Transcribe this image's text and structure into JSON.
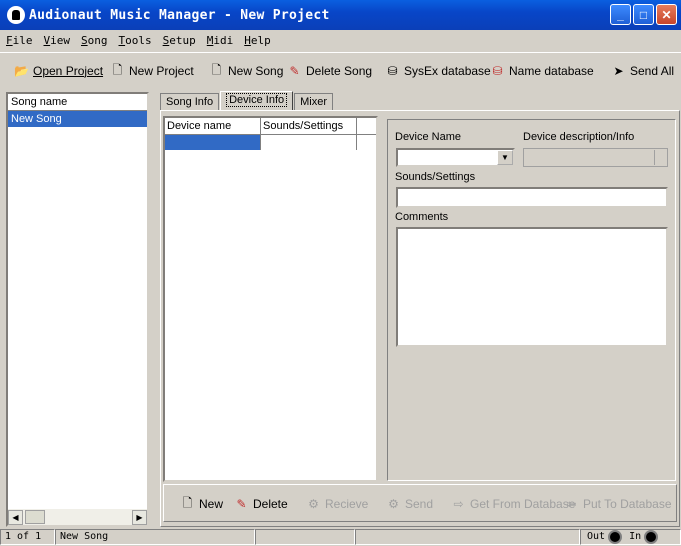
{
  "window": {
    "title": "Audionaut Music Manager - New Project"
  },
  "menu": [
    "File",
    "View",
    "Song",
    "Tools",
    "Setup",
    "Midi",
    "Help"
  ],
  "toolbar": {
    "open_project": "Open Project",
    "new_project": "New Project",
    "new_song": "New Song",
    "delete_song": "Delete Song",
    "sysex_db": "SysEx database",
    "name_db": "Name database",
    "send_all": "Send All"
  },
  "songlist": {
    "header": "Song name",
    "rows": [
      "New Song"
    ]
  },
  "tabs": [
    "Song Info",
    "Device Info",
    "Mixer"
  ],
  "device_table": {
    "col_device": "Device name",
    "col_sounds": "Sounds/Settings"
  },
  "detail": {
    "device_name_label": "Device Name",
    "device_desc_label": "Device description/Info",
    "sounds_label": "Sounds/Settings",
    "comments_label": "Comments"
  },
  "bottom": {
    "new": "New",
    "delete": "Delete",
    "recieve": "Recieve",
    "send": "Send",
    "get_from_db": "Get From Database",
    "put_to_db": "Put To Database"
  },
  "status": {
    "position": "1 of 1",
    "song": "New Song",
    "out": "Out",
    "in": "In"
  }
}
